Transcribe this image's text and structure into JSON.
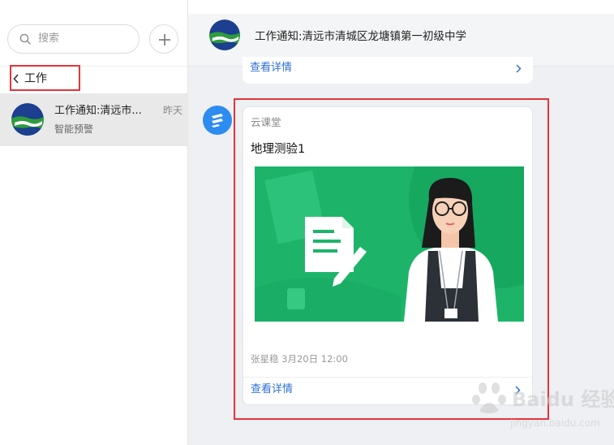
{
  "sidebar": {
    "search_placeholder": "搜索",
    "back_label": "工作",
    "conversations": [
      {
        "title": "工作通知:清远市...",
        "subtitle": "智能预警",
        "time": "昨天"
      }
    ]
  },
  "chat": {
    "title": "工作通知:清远市清城区龙塘镇第一初级中学",
    "prev_card_link": "查看详情",
    "message": {
      "source": "云课堂",
      "title": "地理测验1",
      "meta": "张星稳 3月20日 12:00",
      "detail_link": "查看详情"
    }
  },
  "watermark": {
    "text": "Baidu 经验",
    "sub": "jingyan.baidu.com"
  },
  "colors": {
    "accent": "#2f6fd6",
    "highlight": "#e8323a",
    "illustration_green": "#1db46a",
    "bot_blue": "#2d8cf0"
  }
}
